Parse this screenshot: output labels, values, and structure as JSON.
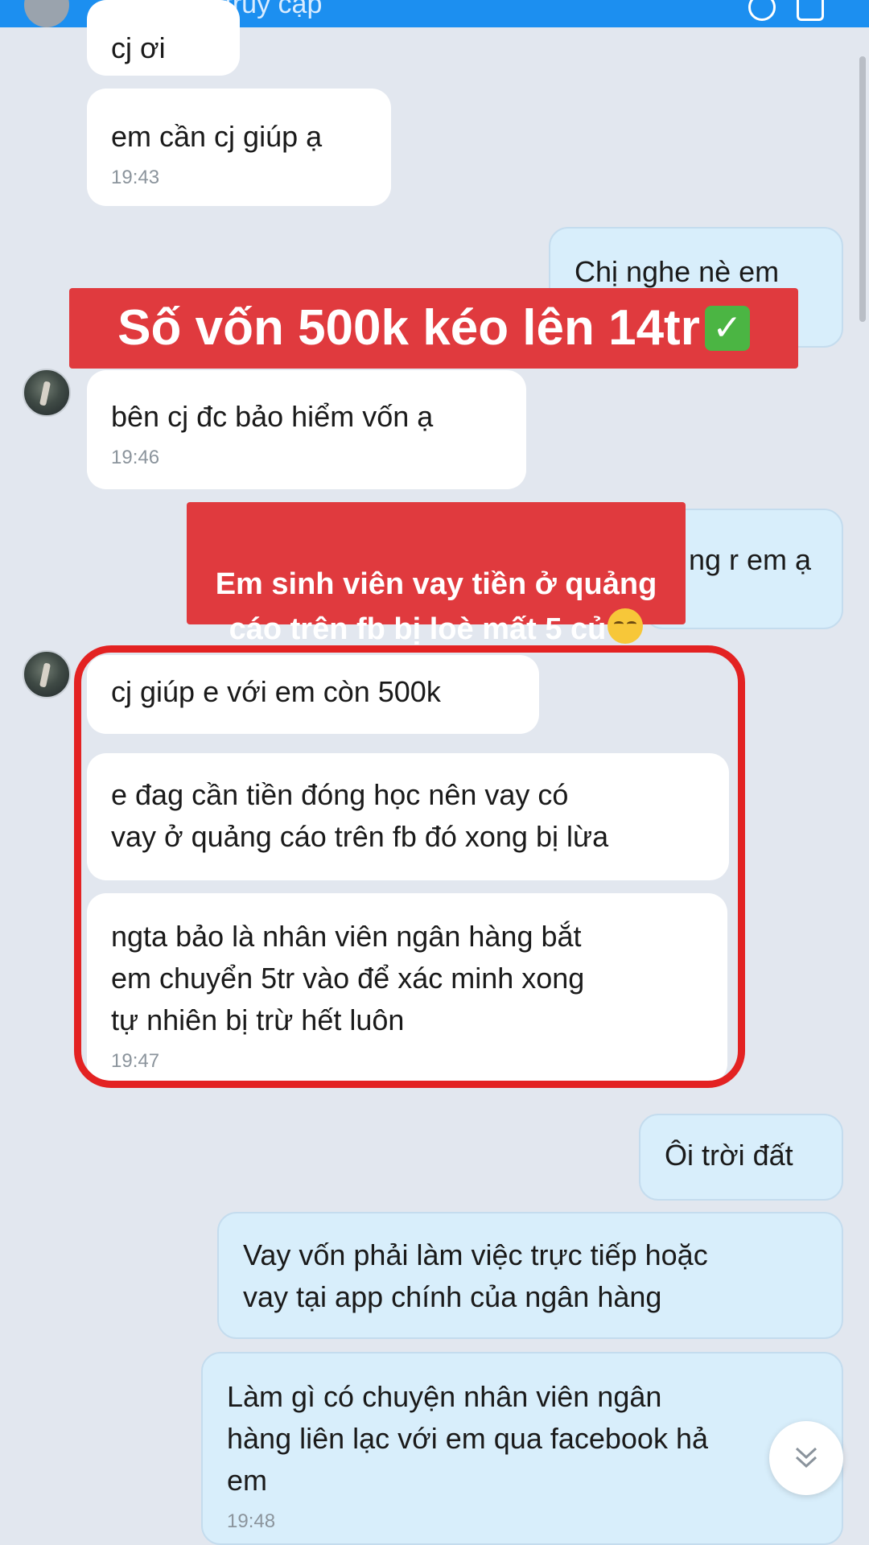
{
  "header": {
    "status": "Vừa mới truy cập"
  },
  "banner": {
    "text": "Số vốn 500k kéo lên 14tr",
    "emoji": "check-mark-emoji"
  },
  "caption": {
    "text": "Em sinh viên vay tiền ở quảng\ncáo trên fb bị loè mất 5 củ",
    "emoji": "relieved-face-emoji"
  },
  "messages": [
    {
      "side": "in",
      "text": "cj ơi",
      "time": ""
    },
    {
      "side": "in",
      "text": "em cần cj giúp ạ",
      "time": "19:43"
    },
    {
      "side": "out",
      "text": "Chị nghe nè em",
      "time": ""
    },
    {
      "side": "in",
      "text": "bên cj đc bảo hiểm vốn ạ",
      "time": "19:46"
    },
    {
      "side": "out",
      "text": "ng r em ạ",
      "time": ""
    },
    {
      "side": "in",
      "text": "cj giúp e với em còn 500k",
      "time": ""
    },
    {
      "side": "in",
      "text": "e đag cần tiền đóng học nên vay có\nvay ở quảng cáo trên fb đó xong bị lừa",
      "time": ""
    },
    {
      "side": "in",
      "text": "ngta bảo là nhân viên ngân hàng bắt\nem chuyển 5tr vào để xác minh xong\ntự nhiên bị trừ hết luôn",
      "time": "19:47"
    },
    {
      "side": "out",
      "text": "Ôi trời đất",
      "time": ""
    },
    {
      "side": "out",
      "text": "Vay vốn phải làm việc trực tiếp hoặc\nvay tại app chính của ngân hàng",
      "time": ""
    },
    {
      "side": "out",
      "text": "Làm gì có chuyện nhân viên ngân\nhàng liên lạc với em qua facebook hả\nem",
      "time": "19:48"
    }
  ],
  "colors": {
    "background": "#e2e7ef",
    "incoming_bubble": "#ffffff",
    "outgoing_bubble": "#d8eefb",
    "overlay_red": "#e03a3e",
    "highlight_red": "#e32222",
    "header_blue": "#1c8ff0"
  }
}
